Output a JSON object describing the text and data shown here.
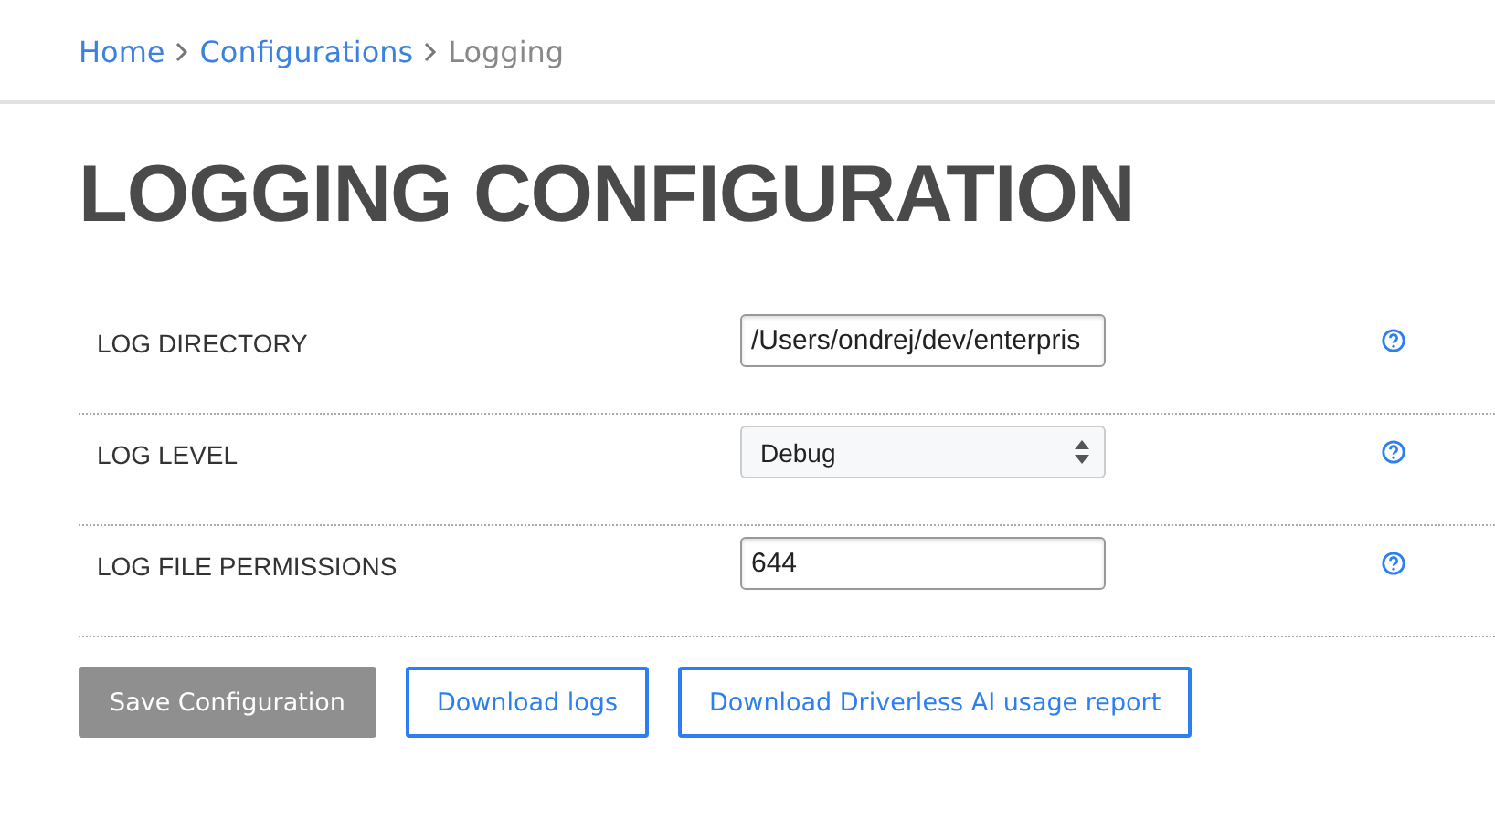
{
  "breadcrumb": [
    {
      "label": "Home",
      "current": false
    },
    {
      "label": "Configurations",
      "current": false
    },
    {
      "label": "Logging",
      "current": true
    }
  ],
  "title": "LOGGING CONFIGURATION",
  "settings": [
    {
      "label": "LOG DIRECTORY",
      "kind": "text",
      "value": "/Users/ondrej/dev/enterpris"
    },
    {
      "label": "LOG LEVEL",
      "kind": "select",
      "value": "Debug"
    },
    {
      "label": "LOG FILE PERMISSIONS",
      "kind": "text",
      "value": "644"
    }
  ],
  "buttons": [
    {
      "label": "Save Configuration",
      "disabled": true
    },
    {
      "label": "Download logs",
      "disabled": false
    },
    {
      "label": "Download Driverless AI usage report",
      "disabled": false
    }
  ]
}
